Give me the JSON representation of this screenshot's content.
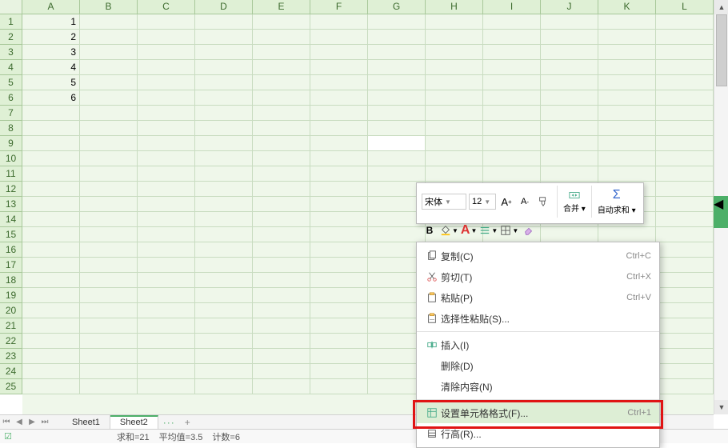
{
  "columns": [
    "A",
    "B",
    "C",
    "D",
    "E",
    "F",
    "G",
    "H",
    "I",
    "J",
    "K",
    "L"
  ],
  "rows_visible": 25,
  "data": {
    "A1": "1",
    "A2": "2",
    "A3": "3",
    "A4": "4",
    "A5": "5",
    "A6": "6"
  },
  "active_cell": "G9",
  "tabs": {
    "nav": [
      "⏮",
      "◀",
      "▶",
      "⏭"
    ],
    "sheets": [
      {
        "name": "Sheet1",
        "active": false
      },
      {
        "name": "Sheet2",
        "active": true
      }
    ],
    "more": "···",
    "add": "+"
  },
  "status": {
    "sum": "求和=21",
    "avg": "平均值=3.5",
    "count": "计数=6"
  },
  "mini_toolbar": {
    "font": "宋体",
    "size": "12",
    "inc": "A⁺",
    "dec": "A⁻",
    "bold": "B",
    "merge": "合并 ▾",
    "autosum": "自动求和 ▾"
  },
  "context_menu": [
    {
      "icon": "copy",
      "label": "复制(C)",
      "shortcut": "Ctrl+C"
    },
    {
      "icon": "cut",
      "label": "剪切(T)",
      "shortcut": "Ctrl+X"
    },
    {
      "icon": "paste",
      "label": "粘贴(P)",
      "shortcut": "Ctrl+V"
    },
    {
      "icon": "paste-special",
      "label": "选择性粘贴(S)...",
      "shortcut": ""
    },
    {
      "icon": "insert",
      "label": "插入(I)",
      "shortcut": ""
    },
    {
      "icon": "",
      "label": "删除(D)",
      "shortcut": ""
    },
    {
      "icon": "",
      "label": "清除内容(N)",
      "shortcut": ""
    },
    {
      "icon": "format",
      "label": "设置单元格格式(F)...",
      "shortcut": "Ctrl+1",
      "highlighted": true
    },
    {
      "icon": "rowheight",
      "label": "行高(R)...",
      "shortcut": ""
    }
  ]
}
